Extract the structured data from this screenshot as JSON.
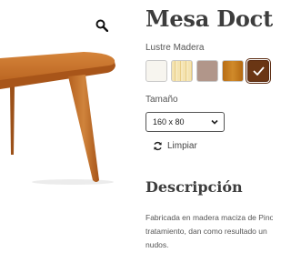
{
  "product": {
    "title": "Mesa Docta",
    "lustre_label": "Lustre Madera",
    "swatches": [
      {
        "name": "blanco",
        "color": "#f7f5ef",
        "selected": false
      },
      {
        "name": "natural",
        "color": "#f1dfa9",
        "selected": false
      },
      {
        "name": "gris",
        "color": "#b1968a",
        "selected": false
      },
      {
        "name": "miel",
        "color": "#c17a1c",
        "selected": false
      },
      {
        "name": "nogal",
        "color": "#6a3614",
        "selected": true
      }
    ],
    "size_label": "Tamaño",
    "size_selected": "160 x 80",
    "clear_label": "Limpiar"
  },
  "description": {
    "heading": "Descripción",
    "lines": [
      "Fabricada en madera maciza de Pino",
      "tratamiento, dan como resultado un",
      "nudos."
    ]
  },
  "icons": {
    "zoom": "magnifier-icon",
    "dropdown": "chevron-down-icon",
    "clear": "refresh-icon",
    "selected": "check-icon"
  },
  "colors": {
    "wood": "#c9722a",
    "heading": "#3d3d3d",
    "selected_border": "#5a2a10"
  }
}
